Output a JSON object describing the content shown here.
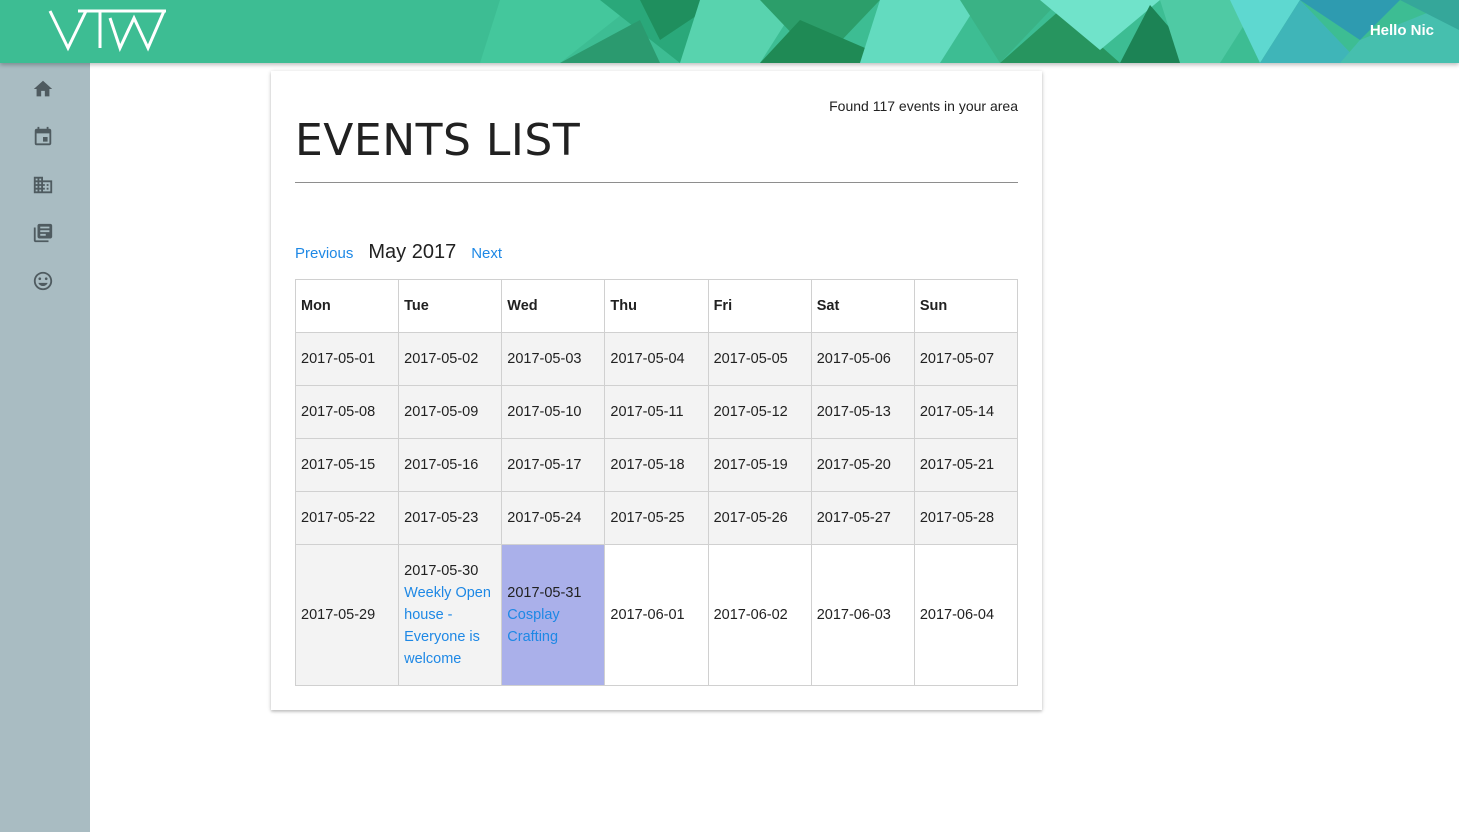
{
  "header": {
    "greeting": "Hello Nic",
    "colors": {
      "base": "#3fbf96",
      "dark": "#1f8a55",
      "light": "#6fe0c4"
    }
  },
  "sidebar": {
    "items": [
      {
        "name": "home",
        "icon": "home-icon"
      },
      {
        "name": "events",
        "icon": "calendar-icon"
      },
      {
        "name": "venues",
        "icon": "building-icon"
      },
      {
        "name": "library",
        "icon": "library-books-icon"
      },
      {
        "name": "profile",
        "icon": "smiley-face-icon"
      }
    ]
  },
  "main": {
    "found_text": "Found 117 events in your area",
    "title": "EVENTS LIST",
    "calendar": {
      "previous_label": "Previous",
      "next_label": "Next",
      "month_label": "May 2017",
      "day_headers": [
        "Mon",
        "Tue",
        "Wed",
        "Thu",
        "Fri",
        "Sat",
        "Sun"
      ],
      "weeks": [
        [
          "2017-05-01",
          "2017-05-02",
          "2017-05-03",
          "2017-05-04",
          "2017-05-05",
          "2017-05-06",
          "2017-05-07"
        ],
        [
          "2017-05-08",
          "2017-05-09",
          "2017-05-10",
          "2017-05-11",
          "2017-05-12",
          "2017-05-13",
          "2017-05-14"
        ],
        [
          "2017-05-15",
          "2017-05-16",
          "2017-05-17",
          "2017-05-18",
          "2017-05-19",
          "2017-05-20",
          "2017-05-21"
        ],
        [
          "2017-05-22",
          "2017-05-23",
          "2017-05-24",
          "2017-05-25",
          "2017-05-26",
          "2017-05-27",
          "2017-05-28"
        ],
        [
          "2017-05-29",
          "2017-05-30",
          "2017-05-31",
          "2017-06-01",
          "2017-06-02",
          "2017-06-03",
          "2017-06-04"
        ]
      ],
      "events": {
        "tue_30": "Weekly Open house - Everyone is welcome",
        "wed_31": "Cosplay Crafting"
      },
      "selected_color": "#aab0ea",
      "link_color": "#1e88e5"
    }
  }
}
